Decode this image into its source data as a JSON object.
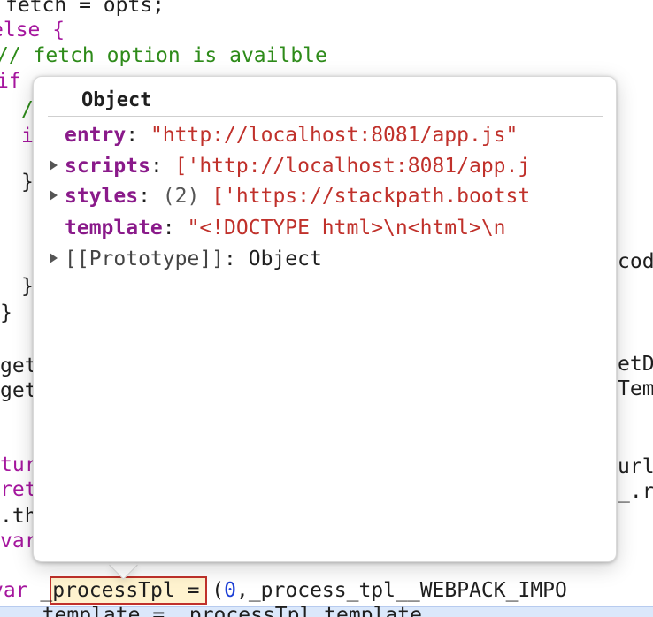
{
  "background_code": {
    "lines": [
      {
        "text": "fetch = opts;",
        "class": "plain"
      },
      {
        "text": "else {",
        "class": "kw"
      },
      {
        "text": "// fetch option is availble",
        "class": "comment"
      },
      {
        "text": "if",
        "class": "kw"
      },
      {
        "text": "/",
        "class": "comment"
      },
      {
        "text": "i",
        "class": "kw"
      },
      {
        "text": "}",
        "class": "plain"
      },
      {
        "text": "}",
        "class": "plain"
      },
      {
        "text": "}",
        "class": "plain"
      },
      {
        "text": "get",
        "class": "plain"
      },
      {
        "text": "get",
        "class": "plain"
      },
      {
        "text": "tur",
        "class": "kw"
      },
      {
        "text": "ret",
        "class": "kw"
      },
      {
        "text": ".th",
        "class": "plain"
      },
      {
        "text": "var",
        "class": "kw"
      }
    ],
    "right_fragments": [
      "cod",
      "etD",
      "Tem",
      "url",
      "_.r"
    ],
    "bottom_line": {
      "keyword": "var",
      "token": "_processTpl",
      "rest_a": " = (",
      "number": "0",
      "rest_b": ",_process_tpl__WEBPACK_IMPO"
    },
    "next_line": "  template = _processTpl.template"
  },
  "popover": {
    "title": "Object",
    "properties": [
      {
        "key": "entry",
        "expandable": false,
        "count": "",
        "value": "\"http://localhost:8081/app.js\""
      },
      {
        "key": "scripts",
        "expandable": true,
        "count": "",
        "value": "['http://localhost:8081/app.j"
      },
      {
        "key": "styles",
        "expandable": true,
        "count": "(2)",
        "value": "['https://stackpath.bootst"
      },
      {
        "key": "template",
        "expandable": false,
        "count": "",
        "value": "\"<!DOCTYPE html>\\n<html>\\n"
      }
    ],
    "prototype": {
      "key": "[[Prototype]]",
      "value": "Object"
    }
  }
}
